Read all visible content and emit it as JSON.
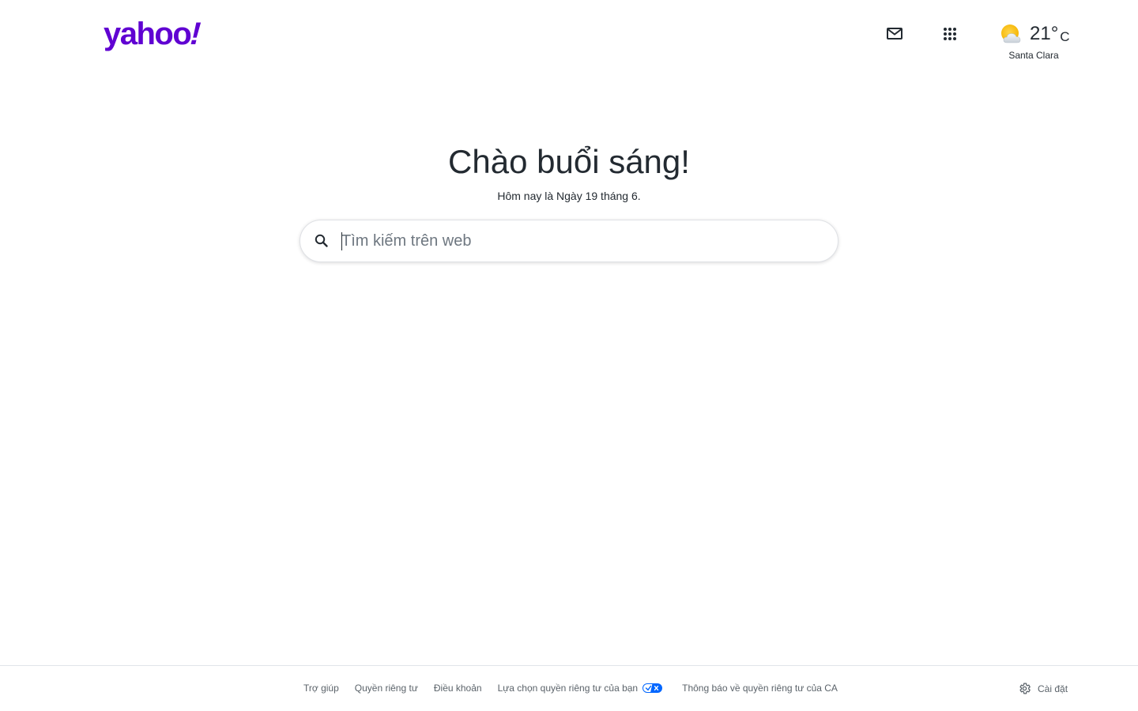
{
  "header": {
    "logo_text": "yahoo",
    "logo_bang": "!",
    "brand_color": "#6001d2",
    "mail_icon": "mail-icon",
    "apps_icon": "apps-grid-icon"
  },
  "weather": {
    "icon": "partly-cloudy-icon",
    "temperature": "21°",
    "unit": "C",
    "city": "Santa Clara"
  },
  "main": {
    "greeting": "Chào buổi sáng!",
    "date_line": "Hôm nay là Ngày 19 tháng 6."
  },
  "search": {
    "placeholder": "Tìm kiếm trên web",
    "value": "",
    "icon": "search-icon"
  },
  "footer": {
    "links": {
      "help": "Trợ giúp",
      "privacy": "Quyền riêng tư",
      "terms": "Điều khoản",
      "privacy_choices": "Lựa chọn quyền riêng tư của bạn",
      "ca_notice": "Thông báo về quyền riêng tư của CA"
    },
    "privacy_choices_icon": "privacy-choices-icon",
    "settings_label": "Cài đặt",
    "settings_icon": "gear-icon"
  },
  "colors": {
    "text": "#232a31",
    "muted": "#5b636a",
    "privacy_toggle": "#0066ff"
  }
}
